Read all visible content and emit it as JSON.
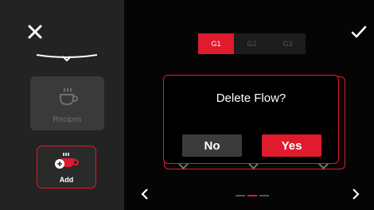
{
  "sidebar": {
    "recipes_label": "Recipes",
    "add_label": "Add"
  },
  "tabs": [
    {
      "label": "G1",
      "active": true
    },
    {
      "label": "G2",
      "active": false
    },
    {
      "label": "G3",
      "active": false
    }
  ],
  "dialog": {
    "message": "Delete Flow?",
    "no_label": "No",
    "yes_label": "Yes"
  },
  "pager": {
    "total": 3,
    "current": 2
  },
  "colors": {
    "accent": "#e01b2d",
    "sidebar": "#232323",
    "background": "#050505"
  },
  "icons": [
    "close-icon",
    "checkmark-icon",
    "cup-icon",
    "add-cup-icon",
    "chevron-left-icon",
    "chevron-right-icon"
  ]
}
